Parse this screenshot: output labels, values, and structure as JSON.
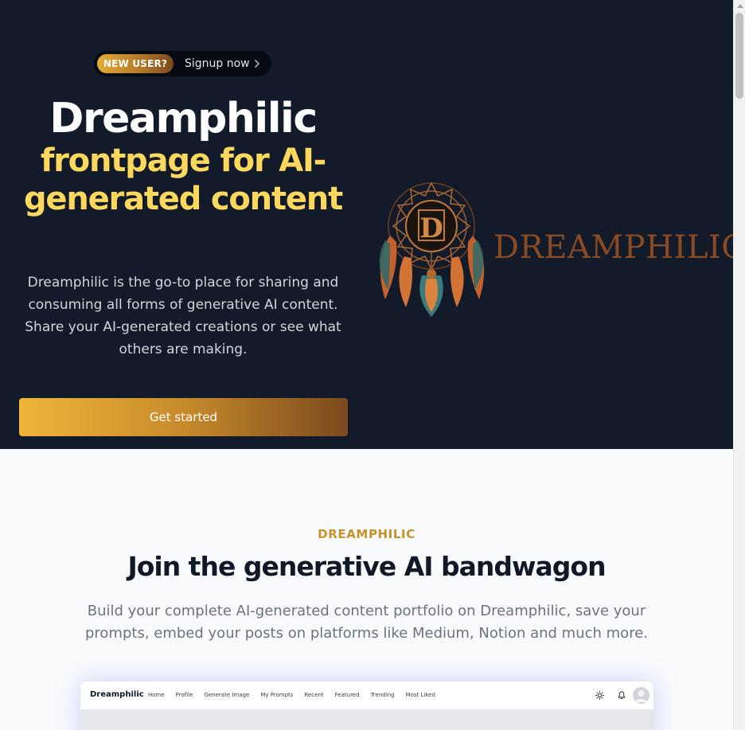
{
  "banner": {
    "badge": "NEW USER?",
    "link_text": "Signup now"
  },
  "hero": {
    "title": "Dreamphilic",
    "subtitle": "frontpage for AI-generated content",
    "description": "Dreamphilic is the go-to place for sharing and consuming all forms of generative AI content. Share your AI-generated creations or see what others are making.",
    "cta": "Get started",
    "logo_text": "DREAMPHILIC"
  },
  "features": {
    "eyebrow": "DREAMPHILIC",
    "title": "Join the generative AI bandwagon",
    "description": "Build your complete AI-generated content portfolio on Dreamphilic, save your prompts, embed your posts on platforms like Medium, Notion and much more."
  },
  "preview": {
    "brand": "Dreamphilic",
    "nav": [
      "Home",
      "Profile",
      "Generate Image",
      "My Prompts",
      "Recent",
      "Featured",
      "Trending",
      "Most Liked"
    ]
  },
  "colors": {
    "hero_bg": "#131a2a",
    "accent_gold": "#fcd95c",
    "eyebrow": "#c8922a",
    "logo_brown": "#8a4a22"
  },
  "icons": [
    "chevron-right-icon",
    "sun-icon",
    "bell-icon",
    "user-avatar-icon",
    "dreamcatcher-logo"
  ]
}
